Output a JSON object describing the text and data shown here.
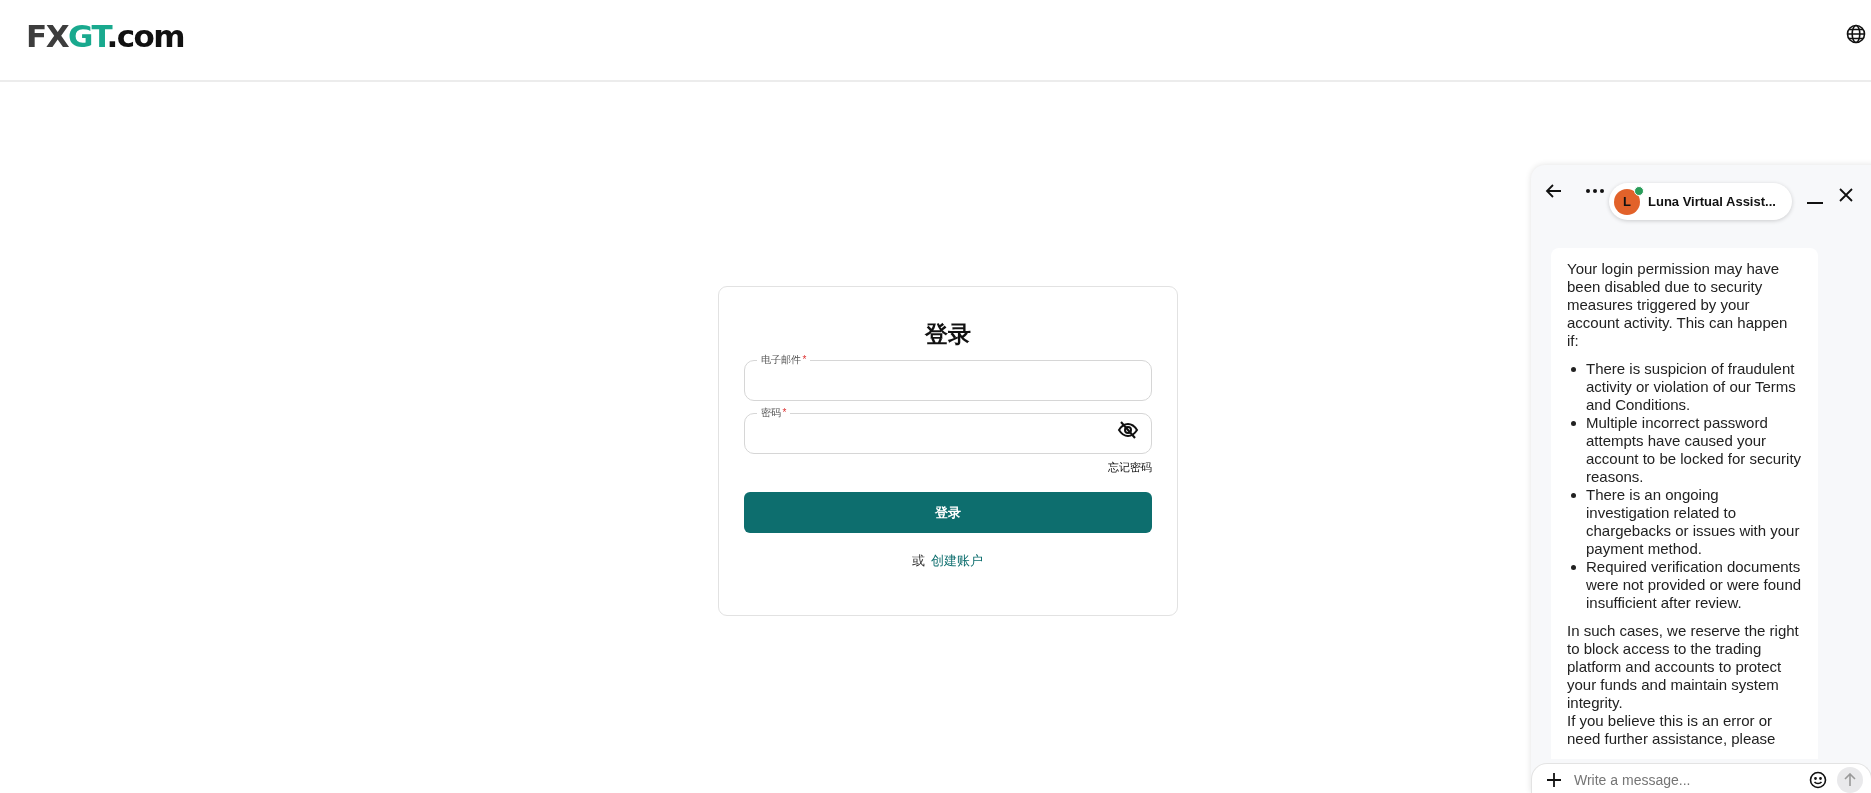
{
  "header": {
    "logo": [
      {
        "text": "FX",
        "color": "#3d3d3d"
      },
      {
        "text": "GT",
        "color": "#19a98e"
      },
      {
        "text": ".com",
        "color": "#111111"
      }
    ]
  },
  "login": {
    "title": "登录",
    "fields": [
      {
        "kind": "email",
        "label": "电子邮件",
        "required_mark": "*"
      },
      {
        "kind": "password",
        "label": "密码",
        "required_mark": "*"
      }
    ],
    "forgot_link": "忘记密码",
    "submit": "登录",
    "alt_prefix": "或",
    "alt_link": "创建账户"
  },
  "chat": {
    "assistant": {
      "name": "Luna Virtual Assist...",
      "avatar_letter": "L",
      "online": true
    },
    "message": [
      {
        "kind": "paragraph",
        "text": "Your login permission may have been disabled due to security measures triggered by your account activity. This can happen if:"
      },
      {
        "kind": "list",
        "items": [
          "There is suspicion of fraudulent activity or violation of our Terms and Conditions.",
          "Multiple incorrect password attempts have caused your account to be locked for security reasons.",
          "There is an ongoing investigation related to chargebacks or issues with your payment method.",
          "Required verification documents were not provided or were found insufficient after review."
        ]
      },
      {
        "kind": "paragraph",
        "text": "In such cases, we reserve the right to block access to the trading platform and accounts to protect your funds and maintain system integrity."
      },
      {
        "kind": "line",
        "text": "If you believe this is an error or need further assistance, please"
      }
    ],
    "input": {
      "placeholder": "Write a message..."
    }
  }
}
